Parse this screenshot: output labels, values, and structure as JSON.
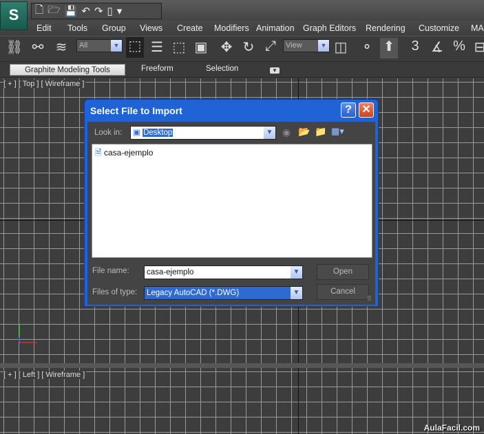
{
  "app": {
    "logo": "S"
  },
  "quick_access": {
    "icons": [
      "new-file-icon",
      "open-folder-icon",
      "save-icon",
      "undo-icon",
      "redo-icon",
      "project-folder-icon",
      "dropdown-icon"
    ]
  },
  "menu": [
    "Edit",
    "Tools",
    "Group",
    "Views",
    "Create",
    "Modifiers",
    "Animation",
    "Graph Editors",
    "Rendering",
    "Customize",
    "MA"
  ],
  "toolbar": {
    "selection_filter": "All",
    "reference_coord": "View"
  },
  "ribbon": {
    "tabs": [
      "Graphite Modeling Tools",
      "Freeform",
      "Selection"
    ]
  },
  "viewports": {
    "top": {
      "label": "[ + ] [ Top ] [ Wireframe ]"
    },
    "left": {
      "label": "[ + ] [ Left ] [ Wireframe ]"
    }
  },
  "dialog": {
    "title": "Select File to Import",
    "help": "?",
    "close": "✕",
    "look_in_label": "Look in:",
    "look_in_value": "Desktop",
    "files": [
      {
        "name": "casa-ejemplo"
      }
    ],
    "file_name_label": "File name:",
    "file_name_value": "casa-ejemplo",
    "files_of_type_label": "Files of type:",
    "files_of_type_value": "Legacy AutoCAD (*.DWG)",
    "open_label": "Open",
    "cancel_label": "Cancel"
  },
  "watermark": "AulaFacil.com",
  "colors": {
    "dialog_title": "#1f63d6",
    "selected": "#2f6ad0",
    "viewport_bg": "#3d3d3d"
  }
}
